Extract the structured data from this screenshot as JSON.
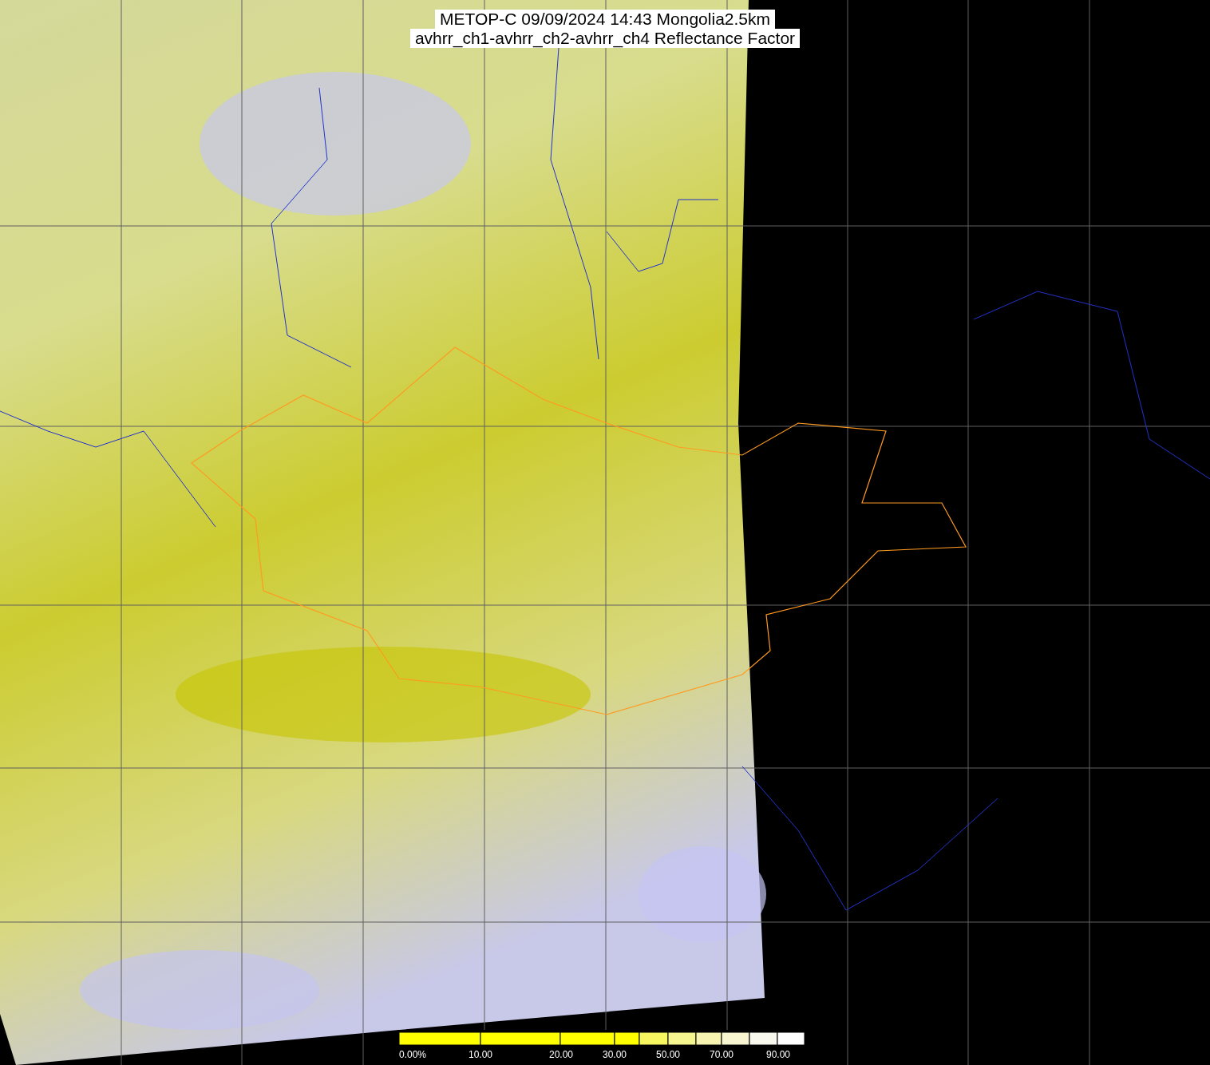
{
  "title": {
    "line_1": "METOP-C 09/09/2024 14:43 Mongolia2.5km",
    "line_2": "avhrr_ch1-avhrr_ch2-avhrr_ch4 Reflectance Factor"
  },
  "legend": {
    "labels": [
      "0.00%",
      "10.00",
      "20.00",
      "30.00",
      "50.00",
      "70.00",
      "90.00"
    ]
  }
}
